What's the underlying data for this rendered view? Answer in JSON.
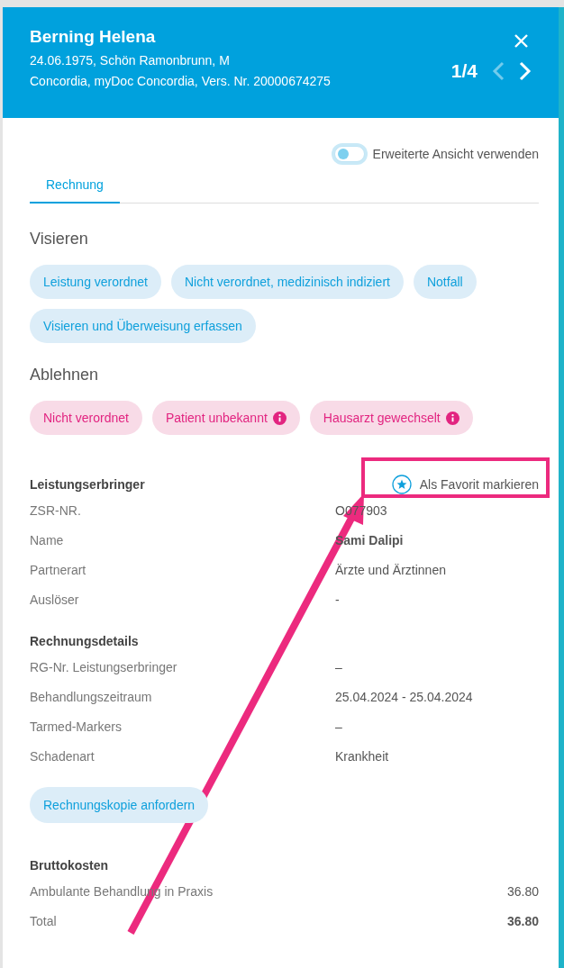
{
  "header": {
    "name": "Berning Helena",
    "info_lines": [
      "24.06.1975, Schön Ramonbrunn, M",
      "Concordia, myDoc Concordia, Vers. Nr. 20000674275"
    ],
    "pager": "1/4",
    "prev": {
      "disabled": true
    },
    "next": {
      "disabled": false
    }
  },
  "toggle": {
    "label": "Erweiterte Ansicht verwenden",
    "on": false
  },
  "tabs": [
    {
      "label": "Rechnung",
      "selected": true
    }
  ],
  "visieren": {
    "title": "Visieren",
    "actions": [
      {
        "label": "Leistung verordnet"
      },
      {
        "label": "Nicht verordnet, medizinisch indiziert"
      },
      {
        "label": "Notfall"
      },
      {
        "label": "Visieren und Überweisung erfassen"
      }
    ]
  },
  "ablehnen": {
    "title": "Ablehnen",
    "actions": [
      {
        "label": "Nicht verordnet",
        "info": false
      },
      {
        "label": "Patient unbekannt",
        "info": true
      },
      {
        "label": "Hausarzt gewechselt",
        "info": true
      }
    ]
  },
  "provider": {
    "title": "Leistungserbringer",
    "favorite": {
      "label": "Als Favorit markieren"
    },
    "rows": [
      {
        "label": "ZSR-NR.",
        "value": "O077903",
        "bold": false
      },
      {
        "label": "Name",
        "value": "Sami Dalipi",
        "bold": true
      },
      {
        "label": "Partnerart",
        "value": "Ärzte und Ärztinnen",
        "bold": false
      },
      {
        "label": "Auslöser",
        "value": "-",
        "bold": false
      }
    ]
  },
  "details": {
    "title": "Rechnungsdetails",
    "rows": [
      {
        "label": "RG-Nr. Leistungserbringer",
        "value": "–",
        "bold": false
      },
      {
        "label": "Behandlungszeitraum",
        "value": "25.04.2024 - 25.04.2024",
        "bold": false
      },
      {
        "label": "Tarmed-Markers",
        "value": "–",
        "bold": false
      },
      {
        "label": "Schadenart",
        "value": "Krankheit",
        "bold": false
      }
    ],
    "button": "Rechnungskopie anfordern"
  },
  "costs": {
    "title": "Bruttokosten",
    "rows": [
      {
        "label": "Ambulante Behandlung in Praxis",
        "value": "36.80",
        "bold": false
      },
      {
        "label": "Total",
        "value": "36.80",
        "bold": true
      }
    ]
  }
}
